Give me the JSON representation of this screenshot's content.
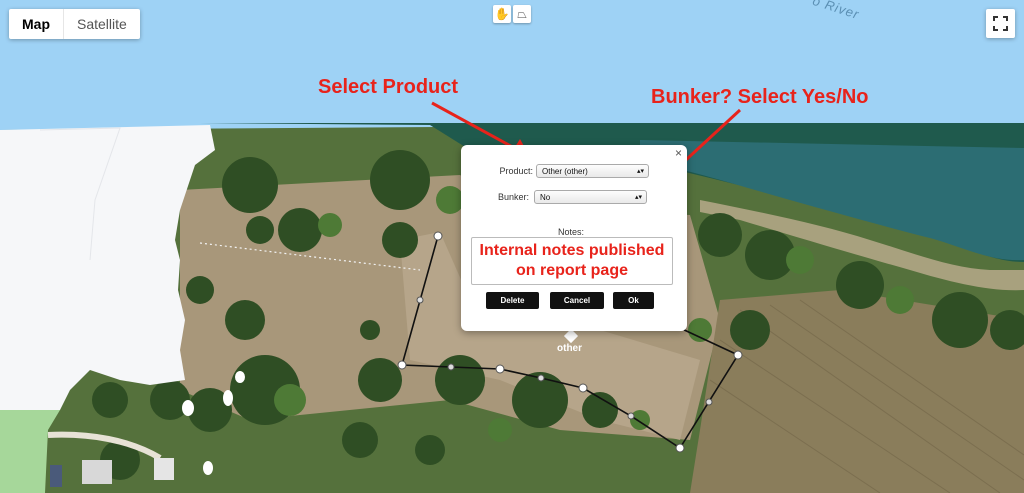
{
  "map": {
    "river_label": "o River",
    "polygon_label": "other"
  },
  "map_type": {
    "map_label": "Map",
    "satellite_label": "Satellite"
  },
  "tools": {
    "pan_icon": "hand-icon",
    "draw_icon": "polygon-icon"
  },
  "fullscreen_icon": "fullscreen-icon",
  "annotations": {
    "product": "Select Product",
    "bunker": "Bunker? Select Yes/No"
  },
  "dialog": {
    "close_label": "×",
    "product_label": "Product:",
    "product_value": "Other (other)",
    "bunker_label": "Bunker:",
    "bunker_value": "No",
    "notes_label": "Notes:",
    "notes_value": "Internal notes published on report page",
    "delete_label": "Delete",
    "cancel_label": "Cancel",
    "ok_label": "Ok"
  },
  "colors": {
    "annotation": "#e8231b",
    "polygon_stroke": "#000000",
    "button_bg": "#111111"
  }
}
